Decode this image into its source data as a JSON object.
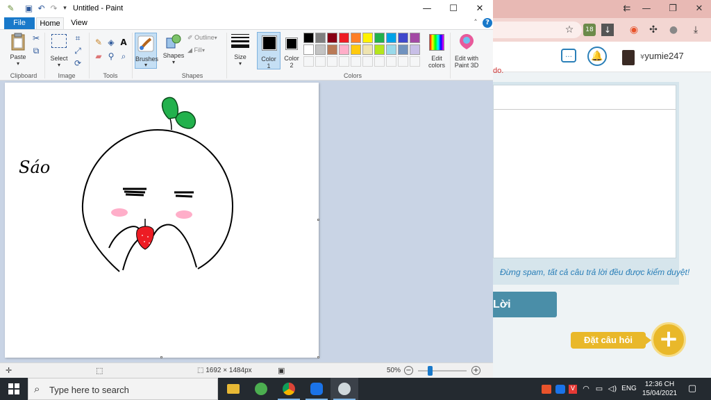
{
  "paint": {
    "title": "Untitled - Paint",
    "tabs": {
      "file": "File",
      "home": "Home",
      "view": "View"
    },
    "groups": {
      "clipboard": "Clipboard",
      "image": "Image",
      "tools": "Tools",
      "shapes": "Shapes",
      "colors": "Colors"
    },
    "buttons": {
      "paste": "Paste",
      "select": "Select",
      "brushes": "Brushes",
      "shapes": "Shapes",
      "outline": "Outline",
      "fill": "Fill",
      "size": "Size",
      "color1": "Color",
      "color1_num": "1",
      "color2": "Color",
      "color2_num": "2",
      "edit_colors_1": "Edit",
      "edit_colors_2": "colors",
      "edit3d_1": "Edit with",
      "edit3d_2": "Paint 3D"
    },
    "palette": [
      "#000000",
      "#7f7f7f",
      "#880015",
      "#ed1c24",
      "#ff7f27",
      "#fff200",
      "#22b14c",
      "#00a2e8",
      "#3f48cc",
      "#a349a4",
      "#ffffff",
      "#c3c3c3",
      "#b97a57",
      "#ffaec9",
      "#ffc90e",
      "#efe4b0",
      "#b5e61d",
      "#99d9ea",
      "#7092be",
      "#c8bfe7"
    ],
    "status": {
      "dimensions": "1692 × 1484px",
      "zoom": "50%"
    },
    "canvas_text": "Sáo"
  },
  "browser": {
    "user": "yumie247",
    "header_snippet": "do.",
    "spam_note": "Đừng spam, tất cả câu trả lời đều được kiểm duyệt!",
    "reply_button": "Lời",
    "ask_button": "Đặt câu hỏi",
    "badge_count": "18"
  },
  "taskbar": {
    "search_placeholder": "Type here to search",
    "lang": "ENG",
    "time": "12:36 CH",
    "date": "15/04/2021"
  }
}
